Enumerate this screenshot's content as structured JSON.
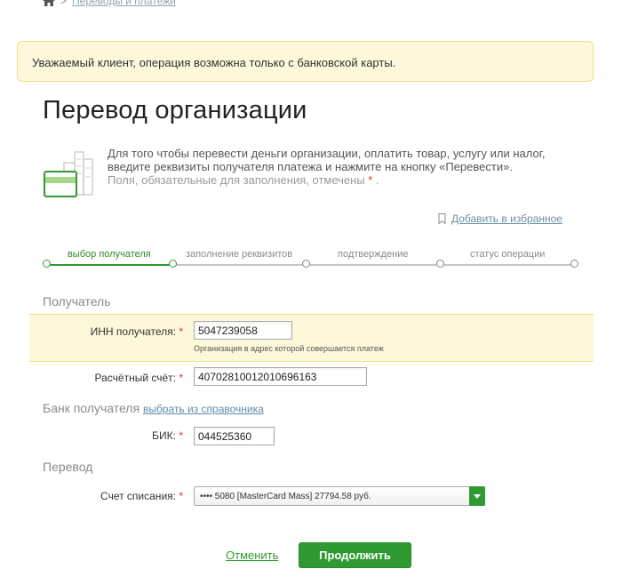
{
  "breadcrumb": {
    "item": "Переводы и платежи"
  },
  "alert": {
    "text": "Уважаемый клиент, операция возможна только с банковской карты."
  },
  "page": {
    "title": "Перевод организации"
  },
  "info": {
    "line1": "Для того чтобы перевести деньги организации, оплатить товар, услугу или налог,",
    "line2": "введите реквизиты получателя платежа и нажмите на кнопку «Перевести».",
    "line3": "Поля, обязательные для заполнения, отмечены",
    "required_mark": "*",
    "line3_end": "."
  },
  "favorites": {
    "label": "Добавить в избранное"
  },
  "steps": [
    {
      "label": "выбор получателя",
      "active": true
    },
    {
      "label": "заполнение реквизитов",
      "active": false
    },
    {
      "label": "подтверждение",
      "active": false
    },
    {
      "label": "статус операции",
      "active": false
    }
  ],
  "sections": {
    "recipient": "Получатель",
    "bank": "Банк получателя",
    "bank_link": "выбрать из справочника",
    "transfer": "Перевод"
  },
  "fields": {
    "inn": {
      "label": "ИНН получателя:",
      "value": "5047239058",
      "hint": "Организация в адрес которой совершается платеж"
    },
    "account": {
      "label": "Расчётный счёт:",
      "value": "40702810012010696163"
    },
    "bik": {
      "label": "БИК:",
      "value": "044525360"
    },
    "debit": {
      "label": "Счет списания:",
      "value": "•••• 5080 [MasterCard Mass] 27794.58 руб."
    },
    "required_mark": "*"
  },
  "actions": {
    "cancel": "Отменить",
    "continue": "Продолжить"
  },
  "colors": {
    "accent": "#2f9a32",
    "alert_bg": "#fdf8d9",
    "required": "#e03030"
  }
}
